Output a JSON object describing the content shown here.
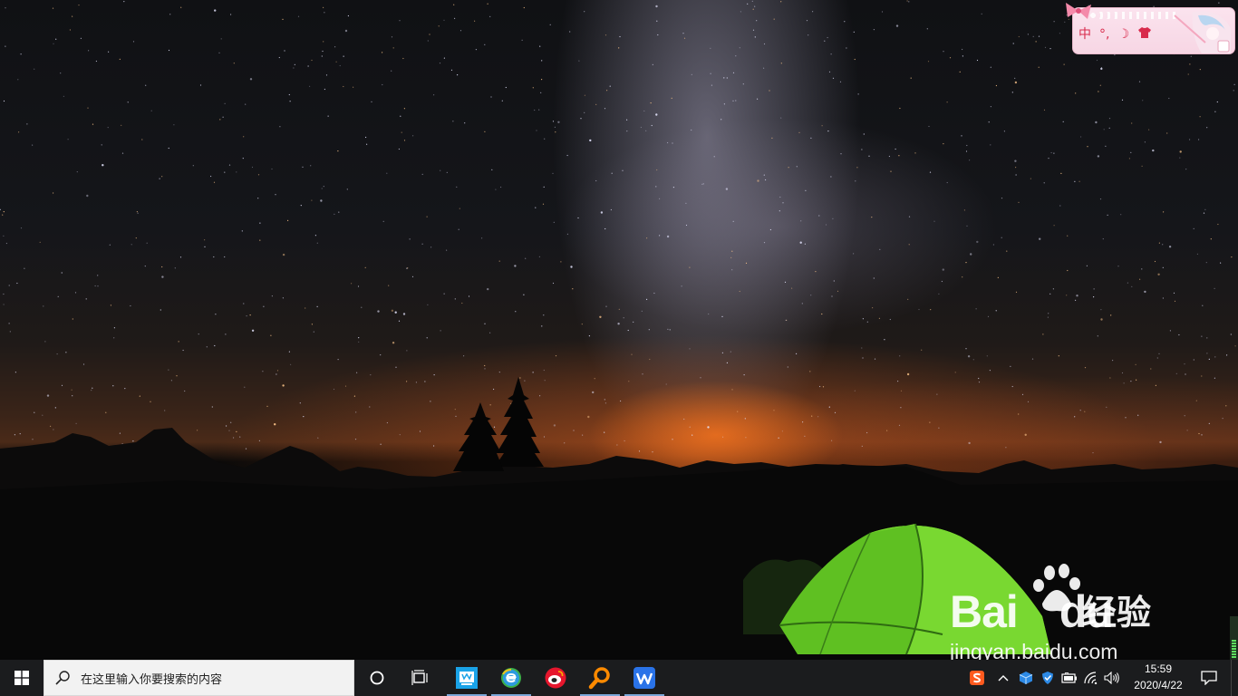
{
  "ime_toolbar": {
    "mode": "中",
    "punct": "°,",
    "moon": "☽",
    "skin": "👕",
    "accent": "#d82b4c"
  },
  "watermark": {
    "logo_text": "Bai",
    "logo_text2": "du",
    "brand_cn": "经验",
    "url": "jingyan.baidu.com"
  },
  "taskbar": {
    "start_icon": "windows-logo-icon",
    "search_placeholder": "在这里输入你要搜索的内容",
    "cortana_icon": "circle-icon",
    "taskview_icon": "task-view-icon",
    "apps": [
      {
        "name": "whiteboard-app-icon",
        "color": "#1aa3e8",
        "active": true
      },
      {
        "name": "browser-e-icon",
        "color": "#2e9be0",
        "active": true
      },
      {
        "name": "weibo-icon",
        "color": "#e6162d",
        "active": false
      },
      {
        "name": "magnifier-search-icon",
        "color": "#ff8a00",
        "active": true
      },
      {
        "name": "wps-icon",
        "color": "#2a73e8",
        "active": true
      }
    ],
    "tray": [
      "sogou-ime-icon",
      "chevron-up-icon",
      "cube-app-icon",
      "shield-icon",
      "battery-icon",
      "wifi-icon",
      "volume-icon"
    ],
    "clock": {
      "time": "15:59",
      "date": "2020/4/22"
    },
    "notify_icon": "notification-icon"
  },
  "side_gauge": {
    "level": 0.45
  }
}
